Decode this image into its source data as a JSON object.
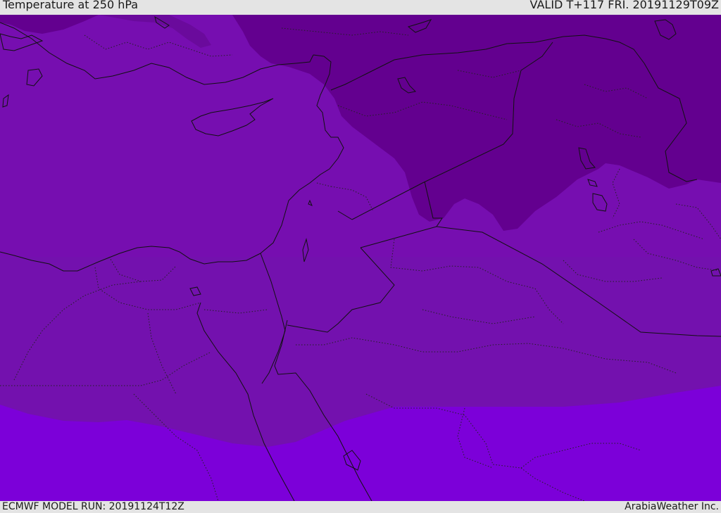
{
  "header": {
    "title": "Temperature at 250 hPa",
    "valid": "VALID T+117 FRI. 20191129T09Z"
  },
  "footer": {
    "model_run": "ECMWF MODEL RUN: 20191124T12Z",
    "brand": "ArabiaWeather Inc."
  },
  "colors": {
    "band_coldest": "#63008f",
    "band_cold": "#760eb0",
    "band_mid": "#7311ae",
    "band_warm": "#7c00d9",
    "boundary_line": "#111111",
    "background": "#e4e4e4"
  }
}
